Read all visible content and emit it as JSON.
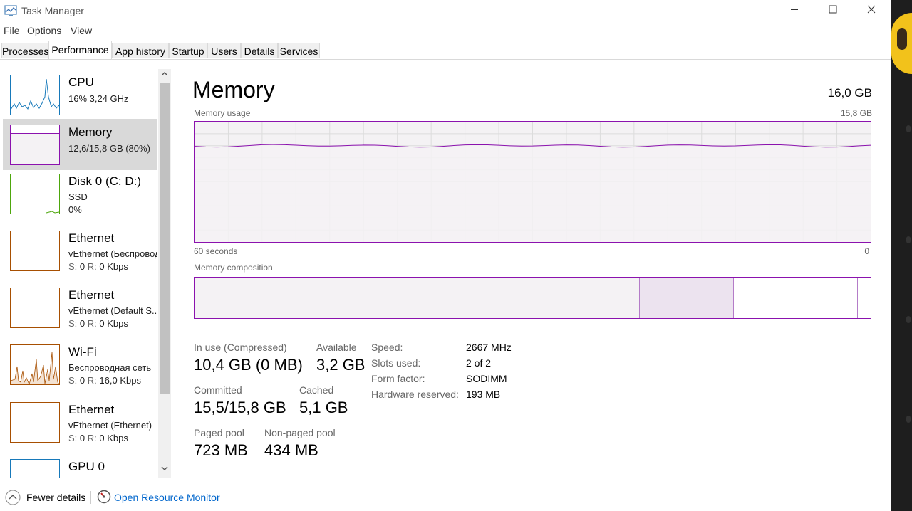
{
  "window": {
    "title": "Task Manager"
  },
  "menu": {
    "file": "File",
    "options": "Options",
    "view": "View"
  },
  "tabs": [
    "Processes",
    "Performance",
    "App history",
    "Startup",
    "Users",
    "Details",
    "Services"
  ],
  "active_tab": "Performance",
  "sidebar": {
    "items": [
      {
        "name": "CPU",
        "line1": "16% 3,24 GHz",
        "color": "#1779ba"
      },
      {
        "name": "Memory",
        "line1": "12,6/15,8 GB (80%)",
        "color": "#8b12ae"
      },
      {
        "name": "Disk 0 (C: D:)",
        "line1": "SSD",
        "line2": "0%",
        "color": "#4da60c"
      },
      {
        "name": "Ethernet",
        "line1": "vEthernet (Беспровод",
        "s_label": "S:",
        "s_value": "0",
        "r_label": "R:",
        "r_value": "0 Kbps",
        "color": "#a74f01"
      },
      {
        "name": "Ethernet",
        "line1": "vEthernet (Default S...",
        "s_label": "S:",
        "s_value": "0",
        "r_label": "R:",
        "r_value": "0 Kbps",
        "color": "#a74f01"
      },
      {
        "name": "Wi-Fi",
        "line1": "Беспроводная сеть",
        "s_label": "S:",
        "s_value": "0",
        "r_label": "R:",
        "r_value": "16,0 Kbps",
        "color": "#a74f01"
      },
      {
        "name": "Ethernet",
        "line1": "vEthernet (Ethernet)",
        "s_label": "S:",
        "s_value": "0",
        "r_label": "R:",
        "r_value": "0 Kbps",
        "color": "#a74f01"
      },
      {
        "name": "GPU 0",
        "color": "#1779ba"
      }
    ]
  },
  "main": {
    "title": "Memory",
    "total": "16,0 GB",
    "usage_label": "Memory usage",
    "usage_max": "15,8 GB",
    "axis_left": "60 seconds",
    "axis_right": "0",
    "composition_label": "Memory composition",
    "stats": {
      "in_use_label": "In use (Compressed)",
      "in_use_value": "10,4 GB (0 MB)",
      "available_label": "Available",
      "available_value": "3,2 GB",
      "committed_label": "Committed",
      "committed_value": "15,5/15,8 GB",
      "cached_label": "Cached",
      "cached_value": "5,1 GB",
      "paged_label": "Paged pool",
      "paged_value": "723 MB",
      "nonpaged_label": "Non-paged pool",
      "nonpaged_value": "434 MB"
    },
    "details": [
      {
        "label": "Speed:",
        "value": "2667 MHz"
      },
      {
        "label": "Slots used:",
        "value": "2 of 2"
      },
      {
        "label": "Form factor:",
        "value": "SODIMM"
      },
      {
        "label": "Hardware reserved:",
        "value": "193 MB"
      }
    ],
    "usage_fraction": 0.8,
    "composition": {
      "in_use_gb": 10.4,
      "modified_gb": 2.2,
      "standby_gb": 2.9,
      "free_gb": 0.3,
      "total_gb": 15.8
    }
  },
  "footer": {
    "fewer_details": "Fewer details",
    "resource_monitor": "Open Resource Monitor"
  },
  "colors": {
    "memory": "#8b12ae",
    "accent_link": "#0066cc"
  }
}
